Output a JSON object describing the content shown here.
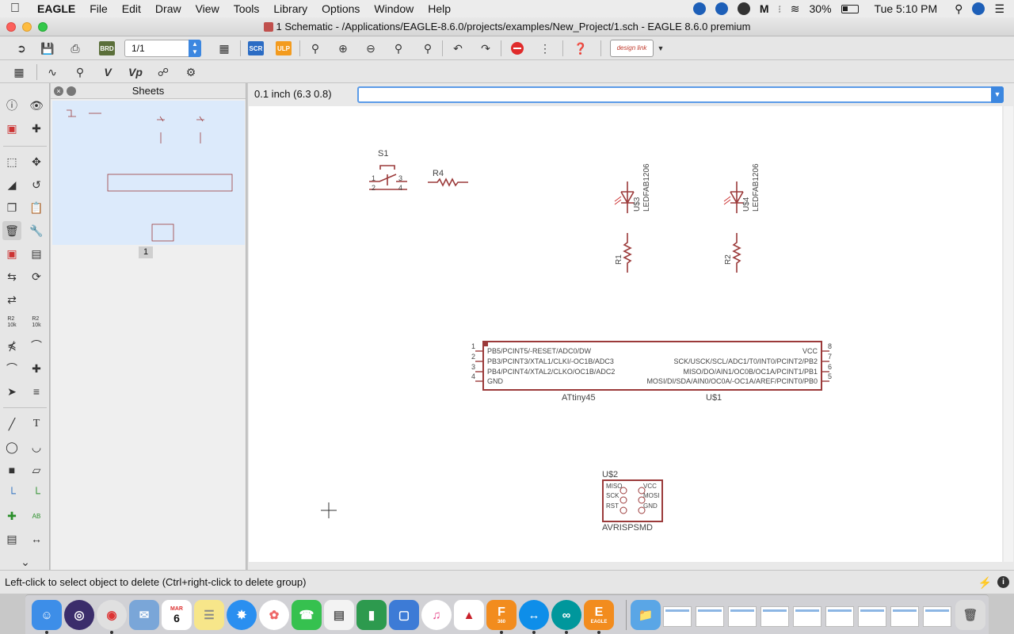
{
  "menubar": {
    "app_name": "EAGLE",
    "items": [
      "File",
      "Edit",
      "Draw",
      "View",
      "Tools",
      "Library",
      "Options",
      "Window",
      "Help"
    ],
    "battery": "30%",
    "clock": "Tue 5:10 PM"
  },
  "window": {
    "title": "1 Schematic - /Applications/EAGLE-8.6.0/projects/examples/New_Project/1.sch - EAGLE 8.6.0 premium"
  },
  "toolbar": {
    "brd_label": "BRD",
    "sheet_select_value": "1/1",
    "scr_label": "SCR",
    "ulp_label": "ULP",
    "design_link_label": "design link"
  },
  "toolbar2": {
    "value_label": "V",
    "vp_label": "Vp"
  },
  "palette": {
    "name_icon_label": "R2\n10k",
    "value_icon_label": "R2\n10k",
    "text_label": "T",
    "label_tool_label": "AB"
  },
  "sheets_panel": {
    "title": "Sheets",
    "sheet_number": "1"
  },
  "canvas": {
    "grid_readout": "0.1 inch (6.3 0.8)",
    "command_value": "",
    "schematic_color": "#9b3a3a",
    "parts": {
      "s1": {
        "name": "S1",
        "pins": [
          "1",
          "2",
          "3",
          "4"
        ]
      },
      "r4": {
        "name": "R4"
      },
      "u3": {
        "name": "U$3",
        "value": "LEDFAB1206"
      },
      "u4": {
        "name": "U$4",
        "value": "LEDFAB1206"
      },
      "r1": {
        "name": "R1"
      },
      "r2": {
        "name": "R2"
      },
      "u1": {
        "name": "U$1",
        "value": "ATtiny45",
        "left_pins": [
          {
            "num": "1",
            "label": "PB5/PCINT5/-RESET/ADC0/DW"
          },
          {
            "num": "2",
            "label": "PB3/PCINT3/XTAL1/CLKI/-OC1B/ADC3"
          },
          {
            "num": "3",
            "label": "PB4/PCINT4/XTAL2/CLKO/OC1B/ADC2"
          },
          {
            "num": "4",
            "label": "GND"
          }
        ],
        "right_pins": [
          {
            "num": "8",
            "label": "VCC"
          },
          {
            "num": "7",
            "label": "SCK/USCK/SCL/ADC1/T0/INT0/PCINT2/PB2"
          },
          {
            "num": "6",
            "label": "MISO/DO/AIN1/OC0B/OC1A/PCINT1/PB1"
          },
          {
            "num": "5",
            "label": "MOSI/DI/SDA/AIN0/OC0A/-OC1A/AREF/PCINT0/PB0"
          }
        ]
      },
      "u2": {
        "name": "U$2",
        "value": "AVRISPSMD",
        "left_pins": [
          "MISO",
          "SCK",
          "RST"
        ],
        "right_pins": [
          "VCC",
          "MOSI",
          "GND"
        ]
      }
    }
  },
  "status": {
    "message": "Left-click to select object to delete (Ctrl+right-click to delete group)"
  },
  "dock": {
    "calendar_month": "MAR",
    "calendar_day": "6",
    "fusion_label": "360",
    "eagle_label": "EAGLE"
  }
}
